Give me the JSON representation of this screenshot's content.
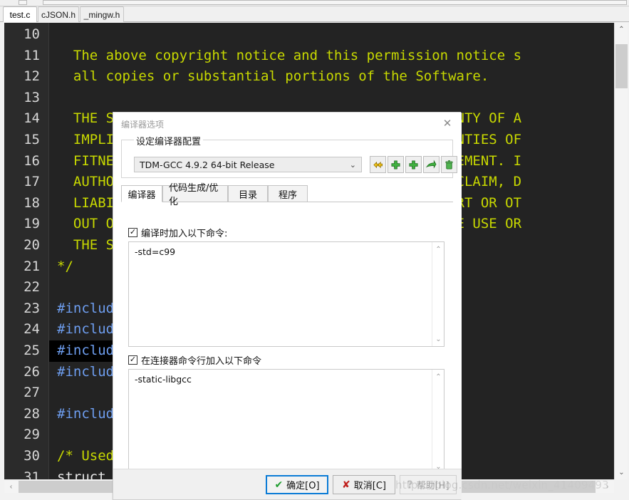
{
  "editor_tabs": [
    {
      "label": "test.c",
      "active": true
    },
    {
      "label": "cJSON.h",
      "active": false
    },
    {
      "label": "_mingw.h",
      "active": false
    }
  ],
  "code": {
    "lines": [
      {
        "number": "10",
        "text": "",
        "kind": "plain"
      },
      {
        "number": "11",
        "text": "  The above copyright notice and this permission notice s",
        "kind": "comment"
      },
      {
        "number": "12",
        "text": "  all copies or substantial portions of the Software.",
        "kind": "comment"
      },
      {
        "number": "13",
        "text": "",
        "kind": "plain"
      },
      {
        "number": "14",
        "text": "  THE SOFTWARE IS PROVIDED \"AS IS\", WITHOUT WARRANTY OF A",
        "kind": "comment"
      },
      {
        "number": "15",
        "text": "  IMPLIED, INCLUDING BUT NOT LIMITED TO THE WARRANTIES OF",
        "kind": "comment"
      },
      {
        "number": "16",
        "text": "  FITNESS FOR A PARTICULAR PURPOSE AND NONINFRINGEMENT. I",
        "kind": "comment"
      },
      {
        "number": "17",
        "text": "  AUTHORS OR COPYRIGHT HOLDERS BE LIABLE FOR ANY CLAIM, D",
        "kind": "comment"
      },
      {
        "number": "18",
        "text": "  LIABILITY, WHETHER IN AN ACTION OF CONTRACT, TORT OR OT",
        "kind": "comment"
      },
      {
        "number": "19",
        "text": "  OUT OF OR IN CONNECTION WITH THE SOFTWARE OR THE USE OR",
        "kind": "comment"
      },
      {
        "number": "20",
        "text": "  THE SOFTWARE.",
        "kind": "comment"
      },
      {
        "number": "21",
        "text": "*/",
        "kind": "comment"
      },
      {
        "number": "22",
        "text": "",
        "kind": "plain"
      },
      {
        "number": "23",
        "text": "#include",
        "kind": "pre"
      },
      {
        "number": "24",
        "text": "#include",
        "kind": "pre"
      },
      {
        "number": "25",
        "text": "#include",
        "kind": "pre",
        "highlight": true
      },
      {
        "number": "26",
        "text": "#include",
        "kind": "pre"
      },
      {
        "number": "27",
        "text": "",
        "kind": "plain"
      },
      {
        "number": "28",
        "text": "#include",
        "kind": "pre"
      },
      {
        "number": "29",
        "text": "",
        "kind": "plain"
      },
      {
        "number": "30",
        "text": "/* Used            datatype. */",
        "kind": "comment"
      },
      {
        "number": "31",
        "text": "struct",
        "kind": "plain"
      }
    ],
    "colors": {
      "background": "#232323",
      "gutter": "#2b2b2b",
      "comment": "#c8d900",
      "preprocessor": "#6e9ef0",
      "plain": "#e8e8e8",
      "line_number": "#d7d7d7",
      "highlight_row": "#000000"
    }
  },
  "dialog": {
    "title": "编译器选项",
    "close_label": "✕",
    "group": {
      "legend": "设定编译器配置",
      "combo_value": "TDM-GCC 4.9.2 64-bit Release",
      "combo_arrow": "⌄",
      "buttons": [
        {
          "name": "rename-config-button",
          "glyph": "✥"
        },
        {
          "name": "add-config-button",
          "glyph": "✚"
        },
        {
          "name": "duplicate-config-button",
          "glyph": "✚"
        },
        {
          "name": "export-config-button",
          "glyph": "➚"
        },
        {
          "name": "delete-config-button",
          "glyph": "🗑"
        }
      ]
    },
    "tabs": [
      {
        "label": "编译器",
        "active": true
      },
      {
        "label": "代码生成/优化",
        "active": false
      },
      {
        "label": "目录",
        "active": false
      },
      {
        "label": "程序",
        "active": false
      }
    ],
    "compiler_section": {
      "checkbox_label": "编译时加入以下命令:",
      "checked": true,
      "check_glyph": "✓",
      "value": "-std=c99",
      "scroll_up": "⌃",
      "scroll_down": "⌄"
    },
    "linker_section": {
      "checkbox_label": "在连接器命令行加入以下命令",
      "checked": true,
      "check_glyph": "✓",
      "value": "-static-libgcc",
      "scroll_up": "⌃",
      "scroll_down": "⌄"
    },
    "footer": {
      "ok": {
        "label": "确定[O]",
        "icon": "✔",
        "icon_color": "#1f9d2f"
      },
      "cancel": {
        "label": "取消[C]",
        "icon": "✘",
        "icon_color": "#c0201d"
      },
      "help": {
        "label": "帮助[H]",
        "icon": "?",
        "disabled": true
      }
    }
  },
  "watermark": "https://blog.csdn.net/weixin_41409493",
  "scrollbars": {
    "v_up": "⌃",
    "v_down": "⌄",
    "h_left": "‹",
    "h_right": "›"
  }
}
